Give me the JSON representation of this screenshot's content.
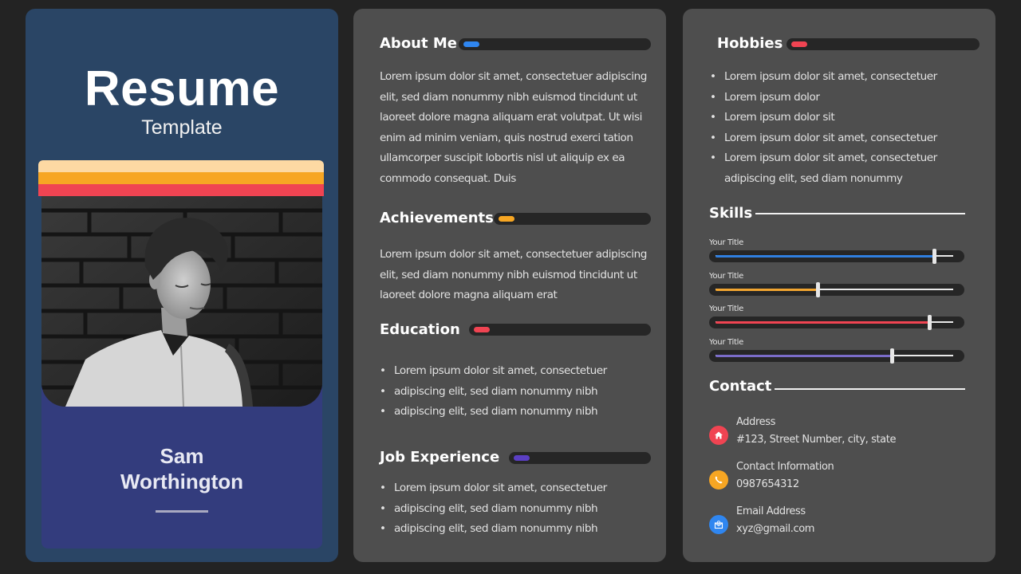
{
  "left": {
    "title": "Resume",
    "subtitle": "Template",
    "name_line1": "Sam",
    "name_line2": "Worthington",
    "stripe_colors": [
      "#fdd9a3",
      "#f7a623",
      "#f04452"
    ],
    "photo_description": "black and white portrait of a young man in front of a brick wall"
  },
  "middle": {
    "about": {
      "title": "About Me",
      "accent": "#2f86f0",
      "text": "Lorem ipsum dolor sit amet, consectetuer adipiscing elit, sed diam nonummy nibh euismod tincidunt ut laoreet dolore magna aliquam erat volutpat. Ut wisi enim ad minim veniam, quis nostrud exerci tation ullamcorper suscipit lobortis nisl ut aliquip ex ea commodo consequat. Duis"
    },
    "achievements": {
      "title": "Achievements",
      "accent": "#f7a623",
      "text": "Lorem ipsum dolor sit amet, consectetuer adipiscing elit, sed diam nonummy nibh euismod tincidunt ut laoreet dolore magna aliquam erat"
    },
    "education": {
      "title": "Education",
      "accent": "#f04452",
      "items": [
        "Lorem ipsum dolor sit amet, consectetuer",
        "adipiscing elit, sed diam nonummy nibh",
        "adipiscing elit, sed diam nonummy nibh"
      ]
    },
    "job": {
      "title": "Job Experience",
      "accent": "#5b3fc4",
      "items": [
        "Lorem ipsum dolor sit amet, consectetuer",
        "adipiscing elit, sed diam nonummy nibh",
        "adipiscing elit, sed diam nonummy nibh"
      ]
    }
  },
  "right": {
    "hobbies": {
      "title": "Hobbies",
      "accent": "#f04452",
      "items": [
        "Lorem ipsum dolor sit amet, consectetuer",
        "Lorem ipsum dolor",
        "Lorem ipsum dolor sit",
        "Lorem ipsum dolor sit amet, consectetuer",
        "Lorem ipsum dolor sit amet, consectetuer adipiscing elit, sed diam nonummy"
      ]
    },
    "skills": {
      "title": "Skills",
      "items": [
        {
          "label": "Your Title",
          "level": 0.92,
          "color": "#2f7fe0"
        },
        {
          "label": "Your Title",
          "level": 0.43,
          "color": "#f2a530"
        },
        {
          "label": "Your Title",
          "level": 0.9,
          "color": "#f04452"
        },
        {
          "label": "Your Title",
          "level": 0.74,
          "color": "#7a6cc8"
        }
      ]
    },
    "contact": {
      "title": "Contact",
      "items": [
        {
          "icon": "home-icon",
          "color": "#f04452",
          "label": "Address",
          "value": "#123, Street Number, city, state"
        },
        {
          "icon": "phone-icon",
          "color": "#f7a623",
          "label": "Contact Information",
          "value": "0987654312"
        },
        {
          "icon": "mail-icon",
          "color": "#2f86f0",
          "label": "Email Address",
          "value": "xyz@gmail.com"
        }
      ]
    }
  }
}
